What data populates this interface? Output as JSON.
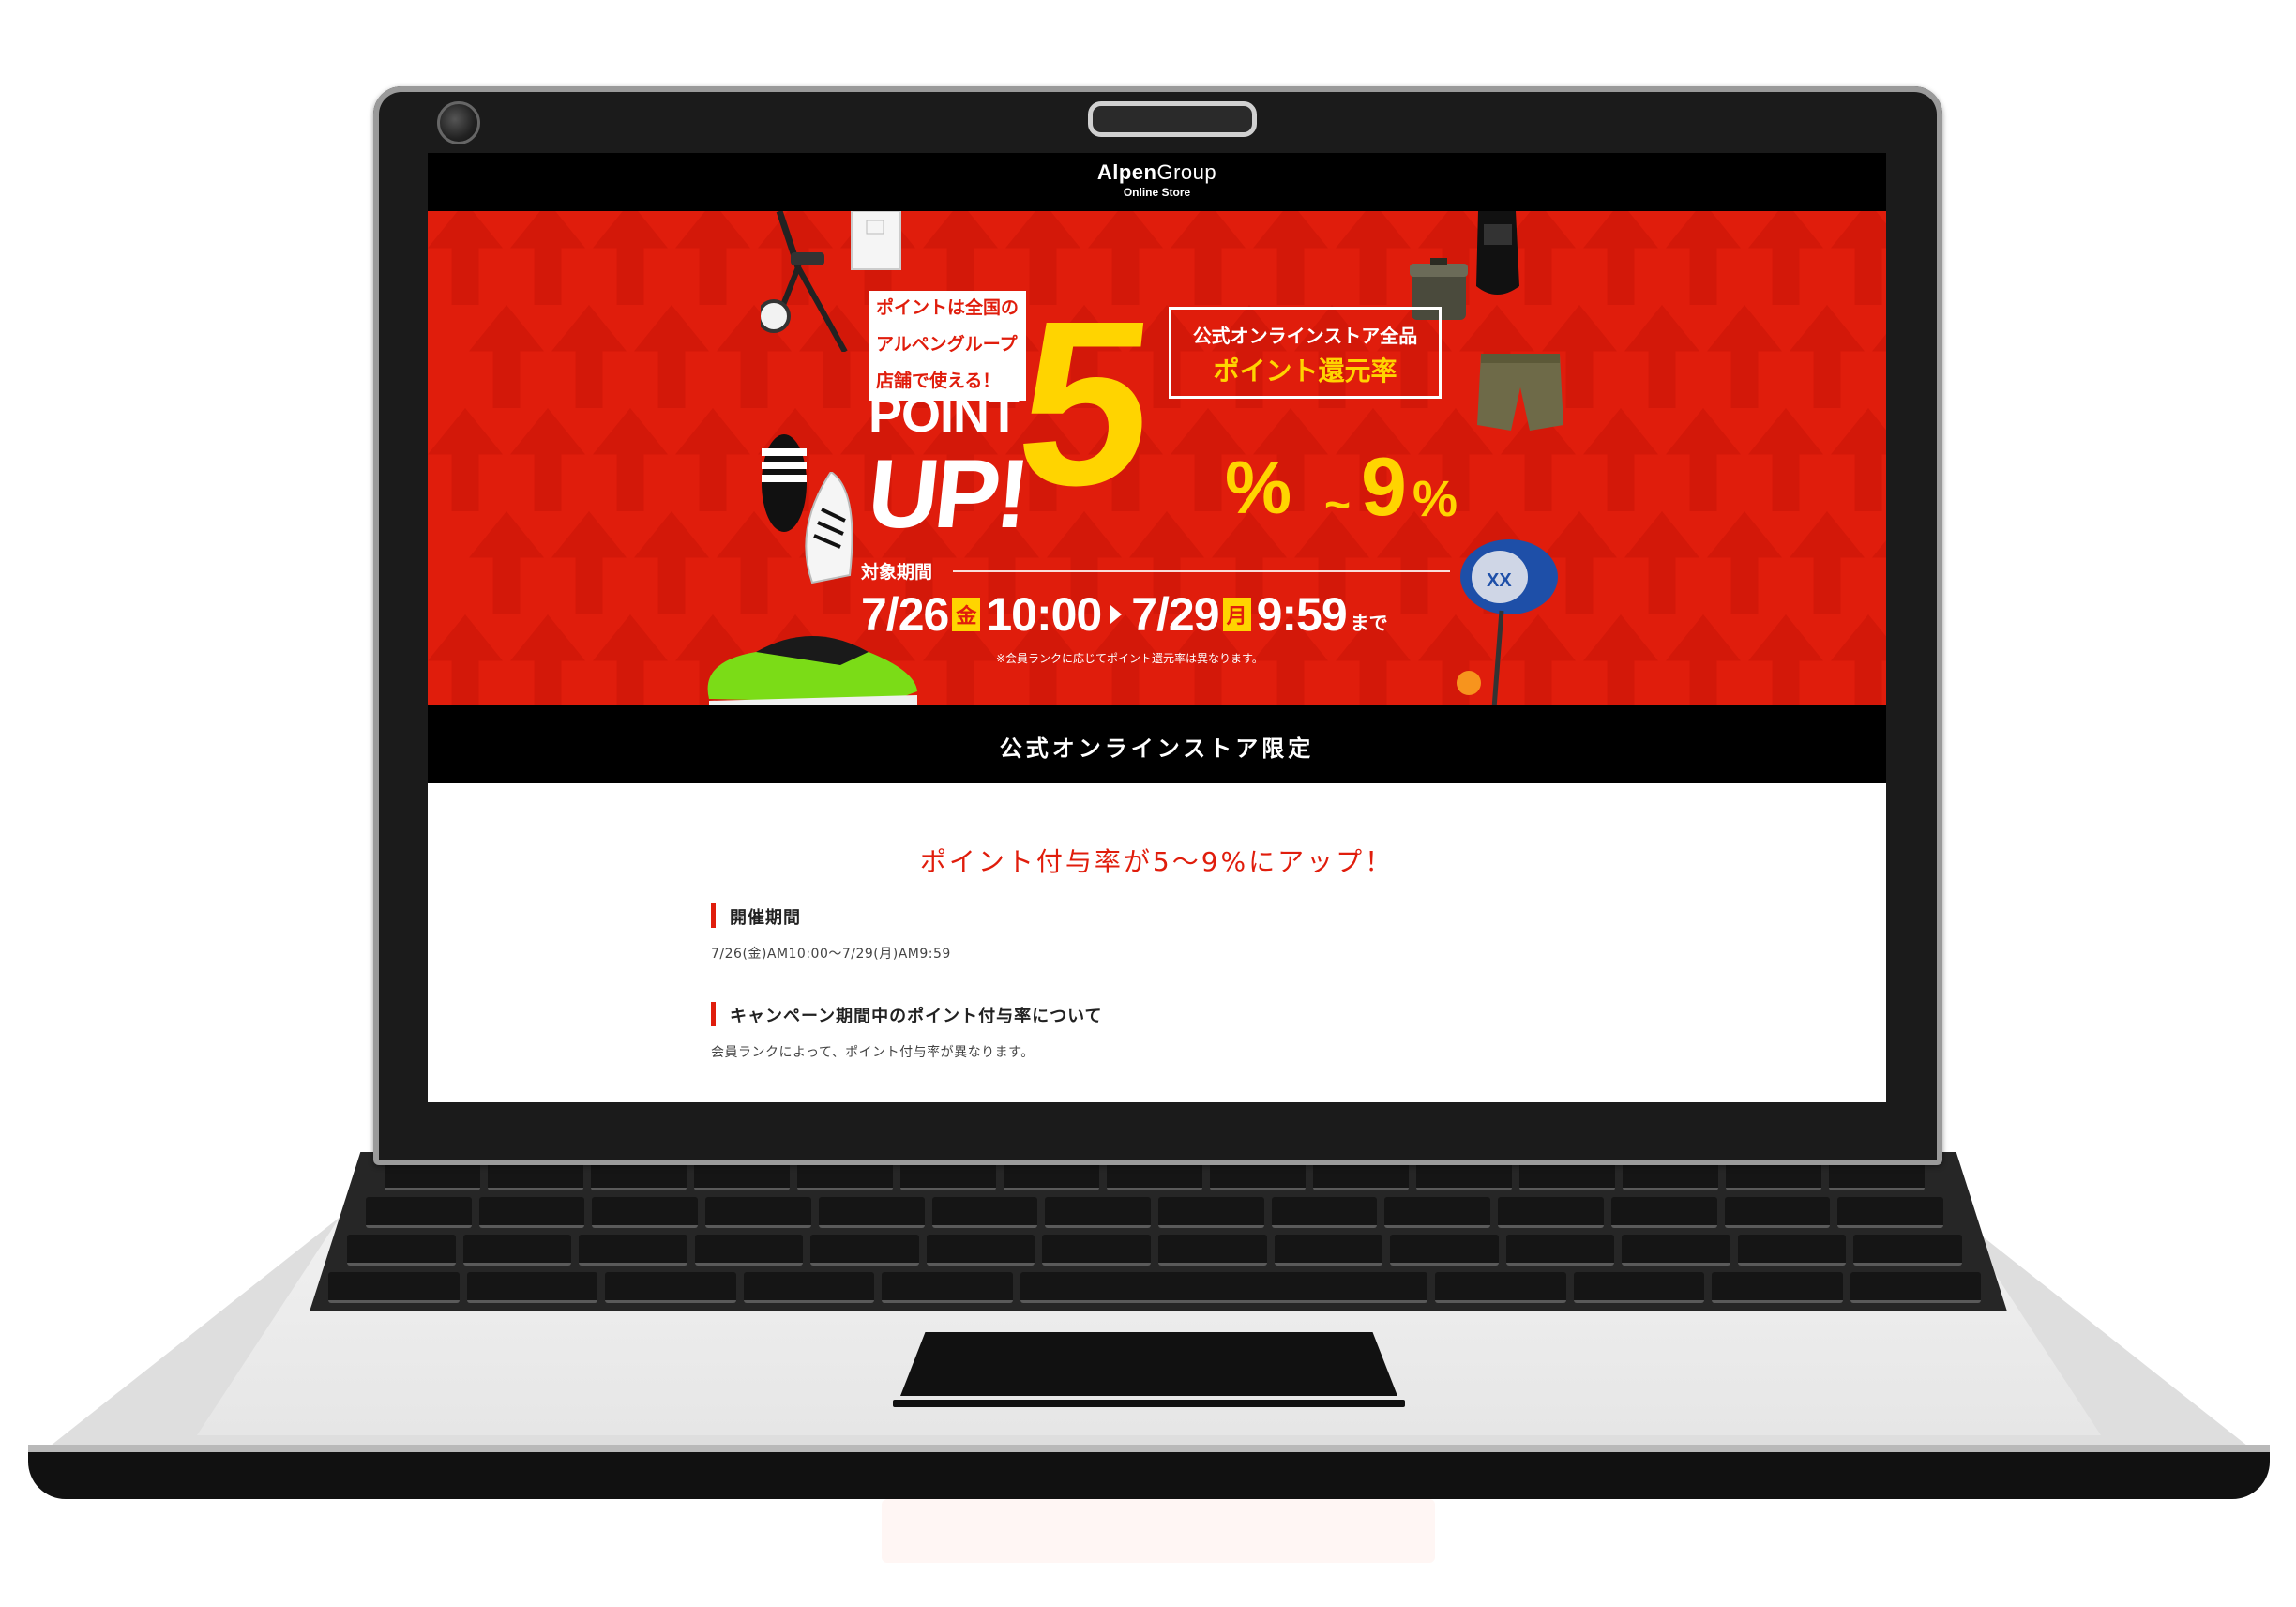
{
  "site_header": {
    "logo_main_bold": "Alpen",
    "logo_main_light": "Group",
    "logo_sub": "Online Store"
  },
  "banner": {
    "note_lines": [
      "ポイントは全国の",
      "アルペングループ",
      "店舗で使える！"
    ],
    "point": "POINT",
    "up": "UP!",
    "rate_box_line1": "公式オンラインストア全品",
    "rate_box_line2": "ポイント還元率",
    "big_digit": "5",
    "pct": "%",
    "tilde": "~",
    "max_digit": "9",
    "period_label": "対象期間",
    "start_date": "7/26",
    "start_day": "金",
    "start_time": "10:00",
    "end_date": "7/29",
    "end_day": "月",
    "end_time": "9:59",
    "until": "まで",
    "note": "※会員ランクに応じてポイント還元率は異なります。",
    "colors": {
      "red": "#e01d0c",
      "yellow": "#ffd400"
    },
    "icons": [
      "exercise-bike-icon",
      "tshirt-icon",
      "slide-sandal-icon",
      "sneaker-icon",
      "running-shoe-icon",
      "cooler-box-icon",
      "sandal-icon",
      "shorts-icon",
      "golf-driver-icon",
      "golf-ball-icon"
    ]
  },
  "limited_bar": {
    "text": "公式オンラインストア限定"
  },
  "content": {
    "headline": "ポイント付与率が5～9%にアップ！",
    "sections": [
      {
        "title": "開催期間",
        "body": "7/26(金)AM10:00～7/29(月)AM9:59"
      },
      {
        "title": "キャンペーン期間中のポイント付与率について",
        "body": "会員ランクによって、ポイント付与率が異なります。"
      }
    ]
  }
}
